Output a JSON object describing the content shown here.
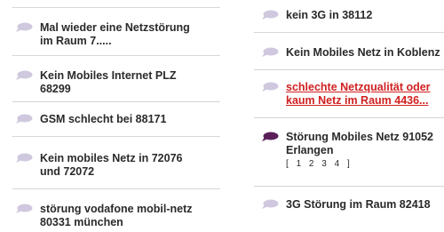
{
  "colors": {
    "bubble_default": "#cfc8de",
    "bubble_active": "#5a1f5a",
    "link": "#d02020",
    "text": "#2a2a2a",
    "separator": "#d6d6d6"
  },
  "left_column": {
    "items": [
      {
        "lines": [
          "Mal wieder eine Netzstörung",
          "im Raum 7....."
        ]
      },
      {
        "lines": [
          "Kein Mobiles Internet PLZ",
          "68299"
        ]
      },
      {
        "lines": [
          "GSM schlecht bei 88171"
        ]
      },
      {
        "lines": [
          "Kein mobiles Netz in 72076",
          "und 72072"
        ]
      },
      {
        "lines": [
          "störung vodafone mobil-netz",
          "80331 münchen"
        ]
      }
    ]
  },
  "right_column": {
    "items": [
      {
        "lines": [
          "kein 3G in 38112"
        ]
      },
      {
        "lines": [
          "Kein Mobiles Netz in Koblenz"
        ]
      },
      {
        "lines": [
          "schlechte Netzqualität oder",
          "kaum Netz im Raum 4436..."
        ]
      },
      {
        "lines": [
          "Störung Mobiles Netz 91052",
          "Erlangen"
        ],
        "pager": {
          "open": "[",
          "pages": [
            "1",
            "2",
            "3",
            "4"
          ],
          "close": "]"
        }
      },
      {
        "lines": [
          "3G Störung im Raum 82418"
        ]
      }
    ]
  }
}
